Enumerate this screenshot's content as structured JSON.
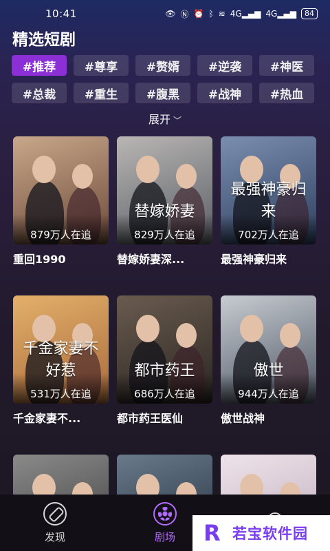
{
  "status": {
    "time": "10:41",
    "battery": "84",
    "signal_a": "4G",
    "signal_b": "4G"
  },
  "page_title": "精选短剧",
  "tags": [
    {
      "label": "#推荐",
      "active": true
    },
    {
      "label": "#尊享"
    },
    {
      "label": "#赘婿"
    },
    {
      "label": "#逆袭"
    },
    {
      "label": "#神医"
    },
    {
      "label": "#总裁"
    },
    {
      "label": "#重生"
    },
    {
      "label": "#腹黑"
    },
    {
      "label": "#战神"
    },
    {
      "label": "#热血"
    }
  ],
  "expand_label": "展开",
  "dramas": [
    {
      "title": "重回1990",
      "views": "879万人在追",
      "overlay": "",
      "colors": [
        "#6b4a3a",
        "#c9a78a"
      ]
    },
    {
      "title": "替嫁娇妻深...",
      "views": "829万人在追",
      "overlay": "替嫁娇妻",
      "colors": [
        "#5a5e66",
        "#b9b6b4"
      ]
    },
    {
      "title": "最强神豪归来",
      "views": "702万人在追",
      "overlay": "最强神豪归来",
      "colors": [
        "#2e3f5e",
        "#7a8eb0"
      ]
    },
    {
      "title": "千金家妻不...",
      "views": "531万人在追",
      "overlay": "千金家妻不好惹",
      "colors": [
        "#a86a3c",
        "#e3b06a"
      ]
    },
    {
      "title": "都市药王医仙",
      "views": "686万人在追",
      "overlay": "都市药王",
      "colors": [
        "#2a2622",
        "#6a5b4f"
      ]
    },
    {
      "title": "傲世战神",
      "views": "944万人在追",
      "overlay": "傲世",
      "colors": [
        "#4c5562",
        "#c8ccd2"
      ]
    },
    {
      "title": "",
      "views": "",
      "overlay": "",
      "colors": [
        "#3a3a3a",
        "#8a8a8a"
      ]
    },
    {
      "title": "",
      "views": "",
      "overlay": "",
      "colors": [
        "#1e2a3a",
        "#6a7a8a"
      ]
    },
    {
      "title": "",
      "views": "",
      "overlay": "",
      "colors": [
        "#b7a9b8",
        "#efe3ea"
      ]
    }
  ],
  "tabbar": [
    {
      "label": "发现",
      "icon": "compass-icon",
      "active": false
    },
    {
      "label": "剧场",
      "icon": "film-reel-icon",
      "active": true
    },
    {
      "label": "",
      "icon": "person-icon",
      "active": false
    }
  ],
  "watermark": {
    "logo": "R",
    "text": "若宝软件园"
  }
}
